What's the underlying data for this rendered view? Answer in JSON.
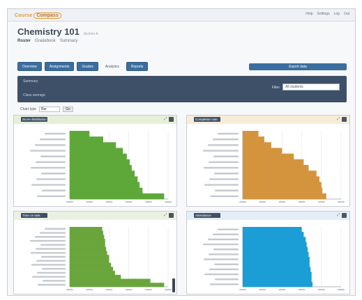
{
  "header": {
    "logo_part1": "Course",
    "logo_part2": "Compass",
    "nav": [
      "Help",
      "Settings",
      "Log",
      "Out"
    ]
  },
  "page": {
    "title": "Chemistry 101",
    "subtitle": "Section A",
    "breadcrumbs": [
      {
        "label": "Roster"
      },
      {
        "label": "Gradebook"
      },
      {
        "label": "Summary"
      }
    ]
  },
  "tabs": [
    "Overview",
    "Assignments",
    "Grades",
    "Analytics",
    "Reports"
  ],
  "tabs_active_index": 3,
  "tab_right_label": "Export data",
  "toolbar": {
    "row1": "Summary",
    "row2": "Class average",
    "filter_label": "Filter",
    "filter_value": "All students"
  },
  "subrow": {
    "label": "Chart type",
    "select_value": "Bar",
    "button": "Go"
  },
  "colors": {
    "green": "#5ea83a",
    "orange": "#d4943d",
    "olive": "#6aa53c",
    "blue": "#1b9ed6"
  },
  "chart_data": [
    {
      "type": "bar",
      "orientation": "horizontal",
      "title": "Score distribution",
      "header_color": "#e6efd9",
      "bar_color": "#5ea83a",
      "values": [
        20,
        34,
        47,
        54,
        58,
        61,
        63,
        66,
        69,
        71,
        74,
        96
      ],
      "xlim": [
        0,
        100
      ],
      "grid": true
    },
    {
      "type": "bar",
      "orientation": "horizontal",
      "title": "Completion rate",
      "header_color": "#f7ecd8",
      "bar_color": "#d4943d",
      "values": [
        16,
        22,
        29,
        40,
        52,
        62,
        67,
        75,
        78,
        80,
        81,
        85
      ],
      "xlim": [
        0,
        100
      ],
      "grid": true
    },
    {
      "type": "bar",
      "orientation": "horizontal",
      "title": "Time on task",
      "header_color": "#eaf1e2",
      "bar_color": "#6aa53c",
      "values": [
        33,
        34,
        35,
        36,
        36,
        37,
        38,
        40,
        40,
        42,
        44,
        46,
        52,
        82,
        96
      ],
      "xlim": [
        0,
        100
      ],
      "grid": true
    },
    {
      "type": "bar",
      "orientation": "horizontal",
      "title": "Attendance",
      "header_color": "#e5eef6",
      "bar_color": "#1b9ed6",
      "values": [
        60,
        62,
        64,
        65,
        66,
        67,
        68,
        68,
        69,
        70,
        70,
        71
      ],
      "xlim": [
        0,
        100
      ],
      "grid": true
    }
  ]
}
